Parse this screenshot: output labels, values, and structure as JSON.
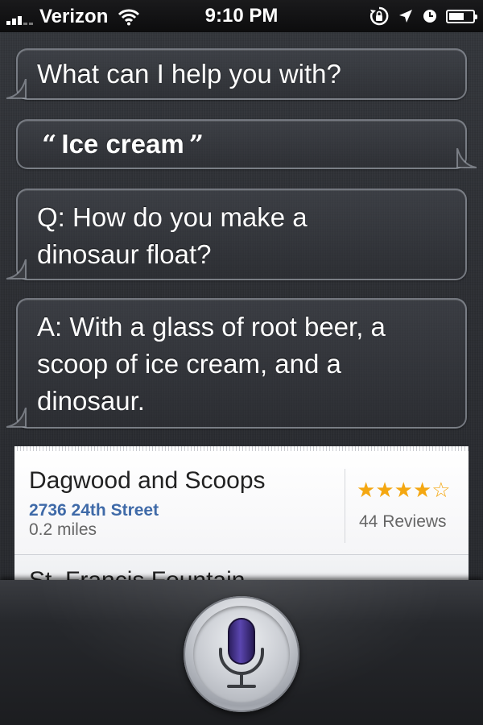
{
  "status_bar": {
    "carrier": "Verizon",
    "time": "9:10 PM",
    "icons": [
      "signal-icon",
      "wifi-icon",
      "rotation-lock-icon",
      "location-arrow-icon",
      "alarm-clock-icon",
      "battery-icon"
    ],
    "battery_level": 0.55
  },
  "conversation": {
    "prompt": "What can I help you with?",
    "user_query": "Ice cream",
    "quote_open": "“",
    "quote_close": "”",
    "answer_q_line1": "Q: How do you make a",
    "answer_q_line2": "dinosaur float?",
    "answer_a_line1": "A: With a glass of root beer, a",
    "answer_a_line2": "scoop of ice cream, and a",
    "answer_a_line3": "dinosaur."
  },
  "results": [
    {
      "name": "Dagwood and Scoops",
      "address": "2736 24th Street",
      "distance": "0.2 miles",
      "rating": 4,
      "rating_max": 5,
      "reviews": "44 Reviews"
    },
    {
      "name": "St. Francis Fountain"
    }
  ],
  "colors": {
    "link_blue": "#3f6aa8",
    "star_gold": "#f4a711",
    "mic_purple": "#3b2a7a"
  }
}
